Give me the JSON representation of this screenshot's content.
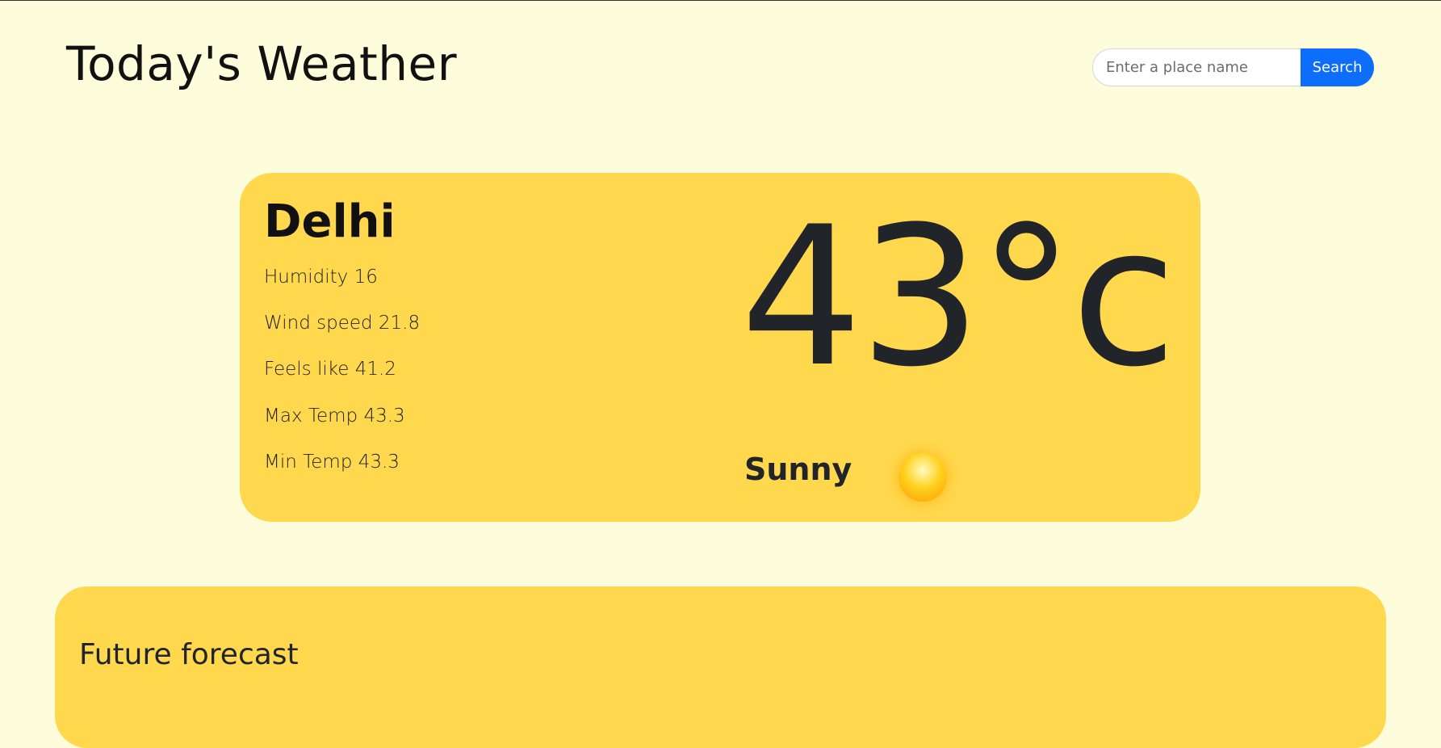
{
  "header": {
    "title": "Today's Weather"
  },
  "search": {
    "placeholder": "Enter a place name",
    "value": "",
    "button_label": "Search"
  },
  "current": {
    "city": "Delhi",
    "humidity": "Humidity 16",
    "wind_speed": "Wind speed 21.8",
    "feels_like": "Feels like 41.2",
    "max_temp": "Max Temp 43.3",
    "min_temp": "Min Temp 43.3",
    "temperature": "43°c",
    "condition": "Sunny",
    "condition_icon": "sun-icon"
  },
  "forecast": {
    "title": "Future forecast"
  },
  "colors": {
    "page_background": "#fdfddb",
    "card_background": "#ffd84d",
    "accent": "#0d6efd"
  }
}
